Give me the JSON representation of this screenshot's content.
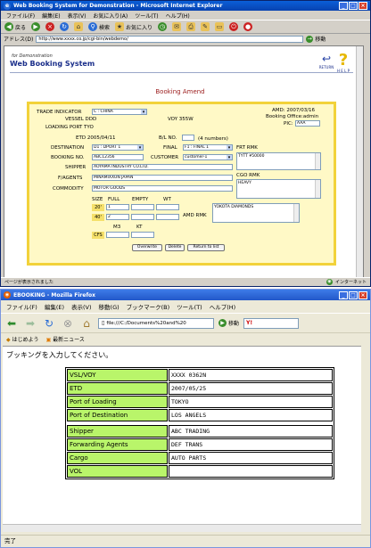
{
  "ie": {
    "title": "Web Booking System for Demonstration - Microsoft Internet Explorer",
    "menu": [
      "ファイル(F)",
      "編集(E)",
      "表示(V)",
      "お気に入り(A)",
      "ツール(T)",
      "ヘルプ(H)"
    ],
    "toolbar": {
      "back": "戻る",
      "search": "検索",
      "favorites": "お気に入り"
    },
    "address_label": "アドレス(D)",
    "address_value": "http://www.xxxx.co.jp/cgi-bin/webdemo/",
    "go_label": "移動",
    "status_left": "ページが表示されました",
    "status_right": "インターネット",
    "app": {
      "subtitle": "for Demonstration",
      "title": "Web Booking System",
      "return_label": "RETURN",
      "help_label": "H E L P"
    },
    "heading": "Booking Amend",
    "form": {
      "trade_indicator_label": "TRADE INDICATOR",
      "trade_indicator": "C : CHINA",
      "amd_label": "AMD: 2007/03/16",
      "booking_office": "Booking Office:admin",
      "pic_label": "PIC:",
      "pic": "AAA",
      "vessel": "VESSEL DDD",
      "voy": "VOY 355W",
      "loading_port": "LOADING PORT TYO",
      "etd": "ETD 2005/04/11",
      "bl_no_label": "B/L NO.",
      "bl_numbers": "(4 numbers)",
      "destination_label": "DESTINATION",
      "destination": "D1 : DPORT 1",
      "final_label": "FINAL",
      "final": "F1 : FINAL 1",
      "frt_rmk_label": "FRT RMK",
      "frt_rmk": "TYTT ¥50000",
      "booking_no_label": "BOOKING NO.",
      "booking_no": "ABC12356",
      "customer_label": "CUSTOMER",
      "customer": "customer-1",
      "shipper_label": "SHIPPER",
      "shipper": "AOYAMA INDUSTRY CO.LTD.",
      "cgo_rmk_label": "CGO RMK",
      "cgo_rmk": "HEAVY",
      "fagents_label": "F/AGENTS",
      "fagents": "MINAMIXXUN JAPAN",
      "commodity_label": "COMMODITY",
      "commodity": "MOTOR GOODS",
      "size_label": "SIZE",
      "full_label": "FULL",
      "empty_label": "EMPTY",
      "wt_label": "WT",
      "size20": "20'",
      "size40": "40'",
      "full20": "1",
      "full40": "2",
      "m3_label": "M3",
      "kt_label": "KT",
      "cfs_label": "CFS",
      "amd_rmk_label": "AMD RMK",
      "amd_rmk": "YOKOTA DIAMONDS",
      "overwrite": "Overwrite",
      "delete": "Delete",
      "return_to_list": "Return to list"
    }
  },
  "ff": {
    "title": "EBOOKING - Mozilla Firefox",
    "menu": [
      "ファイル(F)",
      "編集(E)",
      "表示(V)",
      "移動(G)",
      "ブックマーク(B)",
      "ツール(T)",
      "ヘルプ(H)"
    ],
    "url": "file:///C:/Documents%20and%20",
    "go_label": "移動",
    "bookmarks": [
      "はじめよう",
      "最新ニュース"
    ],
    "prompt": "ブッキングを入力してください。",
    "rows": [
      {
        "key": "VSL/VOY",
        "value": "XXXX 0362N"
      },
      {
        "key": "ETD",
        "value": "2007/05/25"
      },
      {
        "key": "Port of Loading",
        "value": "TOKYO"
      },
      {
        "key": "Port of Destination",
        "value": "LOS ANGELS"
      },
      {
        "key": "Shipper",
        "value": "ABC TRADING"
      },
      {
        "key": "Forwarding Agents",
        "value": "DEF TRANS"
      },
      {
        "key": "Cargo",
        "value": "AUTO PARTS"
      },
      {
        "key": "VOL",
        "value": ""
      }
    ],
    "status": "完了"
  }
}
